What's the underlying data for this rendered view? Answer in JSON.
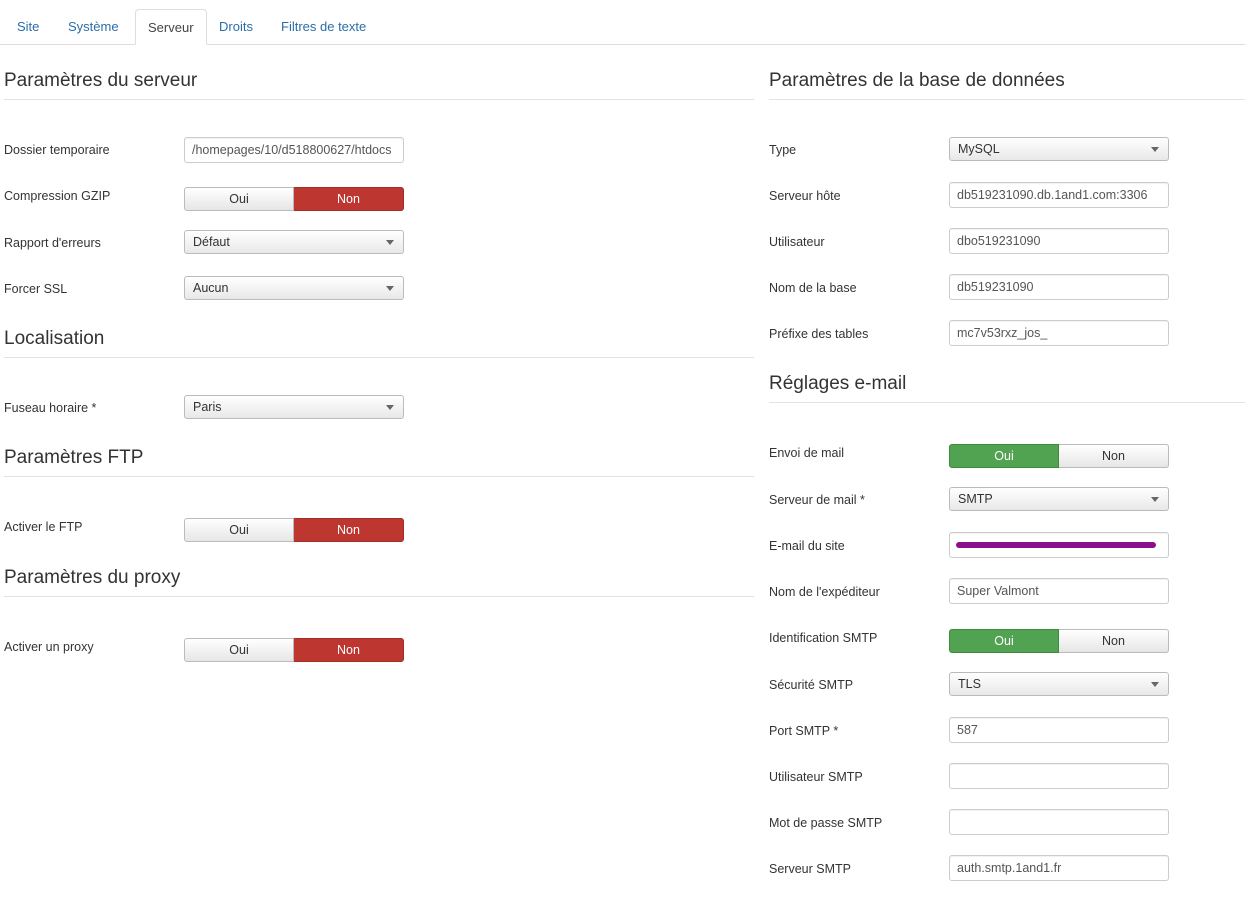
{
  "tabs": [
    "Site",
    "Système",
    "Serveur",
    "Droits",
    "Filtres de texte"
  ],
  "server": {
    "title": "Paramètres du serveur",
    "tmp_label": "Dossier temporaire",
    "tmp_value": "/homepages/10/d518800627/htdocs",
    "gzip_label": "Compression GZIP",
    "error_label": "Rapport d'erreurs",
    "error_value": "Défaut",
    "ssl_label": "Forcer SSL",
    "ssl_value": "Aucun"
  },
  "locale": {
    "title": "Localisation",
    "tz_label": "Fuseau horaire *",
    "tz_value": "Paris"
  },
  "ftp": {
    "title": "Paramètres FTP",
    "enable_label": "Activer le FTP"
  },
  "proxy": {
    "title": "Paramètres du proxy",
    "enable_label": "Activer un proxy"
  },
  "toggle": {
    "yes": "Oui",
    "no": "Non"
  },
  "db": {
    "title": "Paramètres de la base de données",
    "type_label": "Type",
    "type_value": "MySQL",
    "host_label": "Serveur hôte",
    "host_value": "db519231090.db.1and1.com:3306",
    "user_label": "Utilisateur",
    "user_value": "dbo519231090",
    "name_label": "Nom de la base",
    "name_value": "db519231090",
    "prefix_label": "Préfixe des tables",
    "prefix_value": "mc7v53rxz_jos_"
  },
  "mail": {
    "title": "Réglages e-mail",
    "send_label": "Envoi de mail",
    "mailer_label": "Serveur de mail *",
    "mailer_value": "SMTP",
    "from_label": "E-mail du site",
    "fromname_label": "Nom de l'expéditeur",
    "fromname_value": "Super Valmont",
    "auth_label": "Identification SMTP",
    "secure_label": "Sécurité SMTP",
    "secure_value": "TLS",
    "port_label": "Port SMTP *",
    "port_value": "587",
    "smtpuser_label": "Utilisateur SMTP",
    "smtppass_label": "Mot de passe SMTP",
    "smtphost_label": "Serveur SMTP",
    "smtphost_value": "auth.smtp.1and1.fr"
  },
  "colors": {
    "active_no": "#bd362f",
    "active_yes": "#51a351",
    "link": "#2a6ea8"
  }
}
